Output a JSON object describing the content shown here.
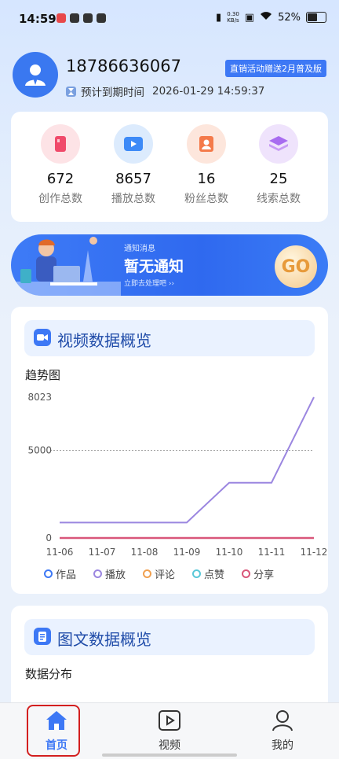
{
  "status_bar": {
    "time": "14:59",
    "net_speed_top": "0.30",
    "net_speed_bottom": "KB/s",
    "battery": "52%"
  },
  "profile": {
    "phone": "18786636067",
    "badge": "直销活动赠送2月普及版",
    "expire_label": "预计到期时间",
    "expire_value": "2026-01-29 14:59:37"
  },
  "stats": [
    {
      "value": "672",
      "label": "创作总数",
      "icon": "creation-icon",
      "color": "#f04a6a"
    },
    {
      "value": "8657",
      "label": "播放总数",
      "icon": "play-icon",
      "color": "#3d8af7"
    },
    {
      "value": "16",
      "label": "粉丝总数",
      "icon": "fans-icon",
      "color": "#f47a4a"
    },
    {
      "value": "25",
      "label": "线索总数",
      "icon": "leads-icon",
      "color": "#a86cf0"
    }
  ],
  "notice": {
    "small": "通知消息",
    "title": "暂无通知",
    "sub": "立即去处理吧",
    "go": "GO"
  },
  "video_card": {
    "title": "视频数据概览",
    "subtitle": "趋势图"
  },
  "chart_data": {
    "type": "line",
    "categories": [
      "11-06",
      "11-07",
      "11-08",
      "11-09",
      "11-10",
      "11-11",
      "11-12"
    ],
    "ylim": [
      0,
      8023
    ],
    "y_ticks": [
      "8023",
      "5000",
      "0"
    ],
    "reference_line": 5000,
    "series": [
      {
        "name": "作品",
        "color": "#3d78f5",
        "values": [
          0,
          0,
          0,
          0,
          0,
          0,
          0
        ]
      },
      {
        "name": "播放",
        "color": "#9b86e0",
        "values": [
          880,
          880,
          880,
          880,
          3150,
          3150,
          8023
        ]
      },
      {
        "name": "评论",
        "color": "#f0a050",
        "values": [
          0,
          0,
          0,
          0,
          0,
          0,
          0
        ]
      },
      {
        "name": "点赞",
        "color": "#5ac8d8",
        "values": [
          0,
          0,
          0,
          0,
          0,
          0,
          0
        ]
      },
      {
        "name": "分享",
        "color": "#d9577a",
        "values": [
          0,
          0,
          0,
          0,
          0,
          0,
          0
        ]
      }
    ]
  },
  "article_card": {
    "title": "图文数据概览",
    "subtitle": "数据分布"
  },
  "tabs": [
    {
      "label": "首页",
      "icon": "home-icon",
      "active": true
    },
    {
      "label": "视频",
      "icon": "video-icon",
      "active": false
    },
    {
      "label": "我的",
      "icon": "user-icon",
      "active": false
    }
  ],
  "colors": {
    "accent": "#3d78f5",
    "highlight": "#d31f1f"
  }
}
